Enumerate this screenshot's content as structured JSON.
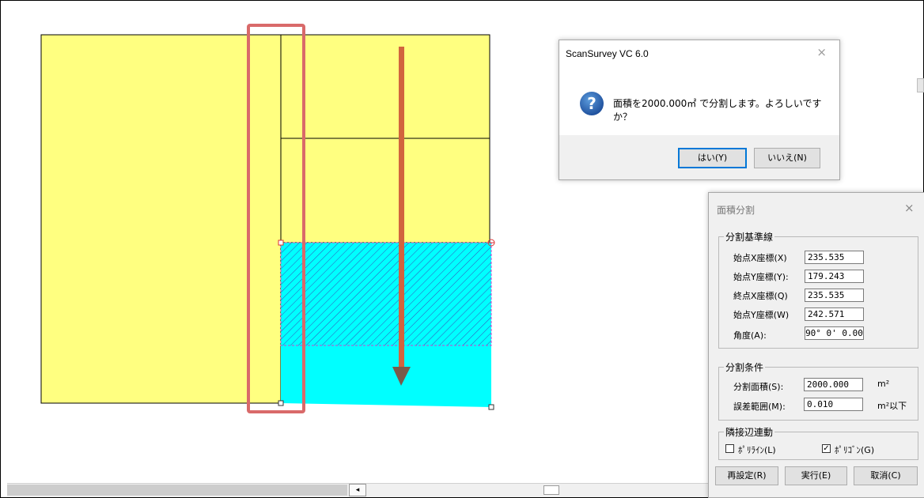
{
  "dialog": {
    "title": "ScanSurvey VC 6.0",
    "close_glyph": "×",
    "icon": "question-icon",
    "icon_glyph": "?",
    "message": "面積を2000.000㎡ で分割します。よろしいですか？",
    "yes_label": "はい(Y)",
    "no_label": "いいえ(N)"
  },
  "panel": {
    "title": "面積分割",
    "close_glyph": "×",
    "baseline_group": {
      "title": "分割基準線",
      "fields": [
        {
          "label": "始点X座標(X)",
          "value": "235.535"
        },
        {
          "label": "始点Y座標(Y):",
          "value": "179.243"
        },
        {
          "label": "終点X座標(Q)",
          "value": "235.535"
        },
        {
          "label": "始点Y座標(W)",
          "value": "242.571"
        },
        {
          "label": "角度(A):",
          "value": "90° 0' 0.00"
        }
      ]
    },
    "condition_group": {
      "title": "分割条件",
      "area_label": "分割面積(S):",
      "area_value": "2000.000",
      "area_unit": "m²",
      "tolerance_label": "誤差範囲(M):",
      "tolerance_value": "0.010",
      "tolerance_unit": "m²以下"
    },
    "adjacent_group": {
      "title": "隣接辺連動",
      "polyline_label": "ﾎﾟﾘﾗｲﾝ(L)",
      "polyline_checked": false,
      "polygon_label": "ﾎﾟﾘｺﾞﾝ(G)",
      "polygon_checked": true,
      "check_glyph": "✓"
    },
    "buttons": {
      "reset_label": "再設定(R)",
      "execute_label": "実行(E)",
      "cancel_label": "取消(C)"
    }
  },
  "scrollbar": {
    "left_arrow_glyph": "◂"
  },
  "colors": {
    "parcel_fill": "#ffff80",
    "selected_fill": "#00ffff",
    "hatch": "#3355bb",
    "highlight_frame": "#d96a6a",
    "arrow": "#d1643e"
  }
}
